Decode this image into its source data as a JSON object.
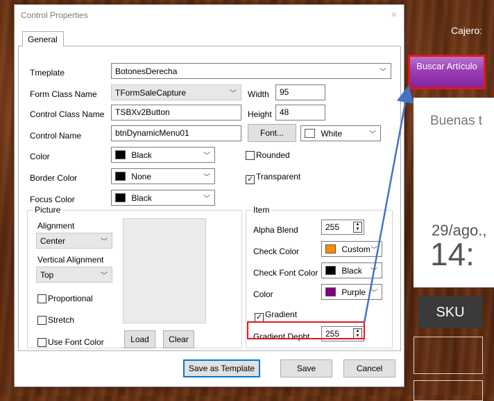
{
  "background_app": {
    "cashier_label": "Cajero:",
    "search_button_label": "Buscar Artículo",
    "greeting": "Buenas t",
    "date": "29/ago.,",
    "time": "14:",
    "sku_button_label": "SKU",
    "accent_color": "#9b3fb4"
  },
  "dialog": {
    "title": "Control Properties",
    "close_icon": "close-icon",
    "tab_general": "General",
    "fields": {
      "template_label": "Tmeplate",
      "template_value": "BotonesDerecha",
      "form_class_label": "Form Class Name",
      "form_class_value": "TFormSaleCapture",
      "width_label": "Width",
      "width_value": "95",
      "control_class_label": "Control Class Name",
      "control_class_value": "TSBXv2Button",
      "height_label": "Height",
      "height_value": "48",
      "control_name_label": "Control Name",
      "control_name_value": "btnDynamicMenu01",
      "font_button": "Font...",
      "font_color_value": "White",
      "color_label": "Color",
      "color_value": "Black",
      "rounded_label": "Rounded",
      "border_color_label": "Border Color",
      "border_color_value": "None",
      "transparent_label": "Transparent",
      "focus_color_label": "Focus Color",
      "focus_color_value": "Black"
    },
    "picture": {
      "group_title": "Picture",
      "alignment_label": "Alignment",
      "alignment_value": "Center",
      "valign_label": "Vertical Alignment",
      "valign_value": "Top",
      "proportional_label": "Proportional",
      "stretch_label": "Stretch",
      "use_font_color_label": "Use Font Color",
      "load_button": "Load",
      "clear_button": "Clear"
    },
    "item": {
      "group_title": "Item",
      "alpha_blend_label": "Alpha Blend",
      "alpha_blend_value": "255",
      "check_color_label": "Check Color",
      "check_color_value": "Custom",
      "check_font_color_label": "Check Font Color",
      "check_font_color_value": "Black",
      "color_label": "Color",
      "color_value": "Purple",
      "gradient_label": "Gradient",
      "gradient_depth_label": "Gradient Depht",
      "gradient_depth_value": "255"
    },
    "buttons": {
      "save_template": "Save as Template",
      "save": "Save",
      "cancel": "Cancel"
    },
    "swatch_colors": {
      "black": "#000000",
      "orange": "#ff8c00",
      "purple": "#800080",
      "white": "#ffffff"
    }
  }
}
